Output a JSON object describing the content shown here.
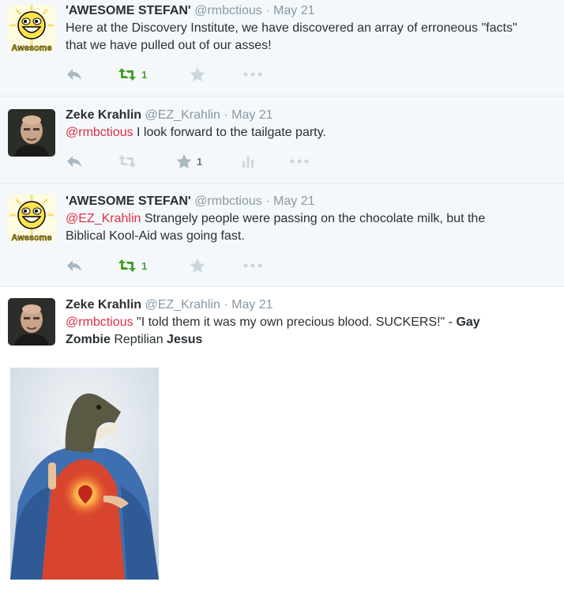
{
  "tweets": [
    {
      "name": "'AWESOME STEFAN'",
      "handle": "@rmbctious",
      "sep": "·",
      "date": "May 21",
      "text_line1": "Here at the Discovery Institute, we have discovered an array of erroneous \"facts\"",
      "text_line2": "that we have pulled out of our asses!",
      "avatar_label": "Awesome",
      "retweet_count": "1"
    },
    {
      "name": "Zeke Krahlin",
      "handle": "@EZ_Krahlin",
      "sep": "·",
      "date": "May 21",
      "mention": "@rmbctious",
      "text": " I look forward to the tailgate party.",
      "favorite_count": "1"
    },
    {
      "name": "'AWESOME STEFAN'",
      "handle": "@rmbctious",
      "sep": "·",
      "date": "May 21",
      "mention": "@EZ_Krahlin",
      "text_line1": " Strangely people were passing on the chocolate milk, but the",
      "text_line2": "Biblical Kool-Aid was going fast.",
      "avatar_label": "Awesome",
      "retweet_count": "1"
    },
    {
      "name": "Zeke Krahlin",
      "handle": "@EZ_Krahlin",
      "sep": "·",
      "date": "May 21",
      "mention": "@rmbctious",
      "text_line1": " \"I told them it was my own precious blood. SUCKERS!\" - ",
      "bold1": "Gay",
      "bold2": "Zombie",
      "text_line2": " Reptilian ",
      "bold3": "Jesus"
    }
  ],
  "colors": {
    "mention": "#dd2e44",
    "retweet_active": "#4a9d2f",
    "muted": "#8899a6",
    "icon": "#aab8c2",
    "alt_bg": "#f5f8fa"
  }
}
